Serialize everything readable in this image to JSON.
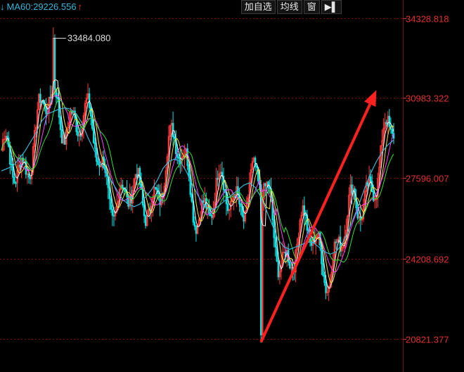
{
  "indicator": {
    "name": "MA60",
    "separator": ":",
    "value": "29226.556",
    "trend_icon": "arrow-up-icon",
    "collapse_icon": "arrow-down-icon"
  },
  "toolbar": {
    "add_watchlist_label": "加自选",
    "ma_label": "均线",
    "window_label": "窗",
    "collapse_icon": "collapse-right-icon"
  },
  "colors": {
    "background": "#000000",
    "axis_label": "#e03030",
    "grid_line": "#7a0e0e",
    "ma_cyan": "#39b5d9",
    "arrow_red": "#ff2020",
    "candle_up": "#ff3838",
    "candle_down": "#00e8e8"
  },
  "chart_data": {
    "type": "candlestick",
    "title": "",
    "xlabel": "",
    "ylabel": "",
    "ylim": [
      19500,
      34500
    ],
    "y_ticks": [
      "34328.818",
      "30983.322",
      "27596.007",
      "24208.692",
      "20821.377"
    ],
    "y_tick_values": [
      34328.818,
      30983.322,
      27596.007,
      24208.692,
      20821.377
    ],
    "high_annotation": {
      "label": "33484.080",
      "value": 33484.08
    },
    "series": [
      {
        "name": "MA60",
        "values": [
          27900,
          28000,
          28100,
          28400,
          28700,
          29100,
          29500,
          30000,
          30300,
          30400,
          30500,
          30550,
          30500,
          30300,
          29900,
          29300,
          28800,
          28300,
          27900,
          27500,
          27100,
          26700,
          26500,
          26400,
          26500,
          26800,
          27100,
          27500,
          28000,
          28300,
          28400,
          28300,
          27900,
          27400,
          26900,
          26500,
          26300,
          26300,
          26500,
          26700,
          26900,
          27100,
          27300,
          27400,
          27200,
          26800,
          26200,
          25600,
          25000,
          24700,
          24600,
          24700,
          24800,
          24900,
          24900,
          24700,
          24500,
          24400,
          24500,
          24800,
          25300,
          25900,
          26500,
          27200,
          27800,
          28300,
          28700,
          29000,
          29200
        ]
      }
    ],
    "annotations": [
      {
        "type": "trend-arrow",
        "direction": "up",
        "from": {
          "index": 45,
          "value": 20700
        },
        "to": {
          "index": 65,
          "value": 31300
        }
      }
    ],
    "grid": true,
    "legend": "top-left"
  }
}
